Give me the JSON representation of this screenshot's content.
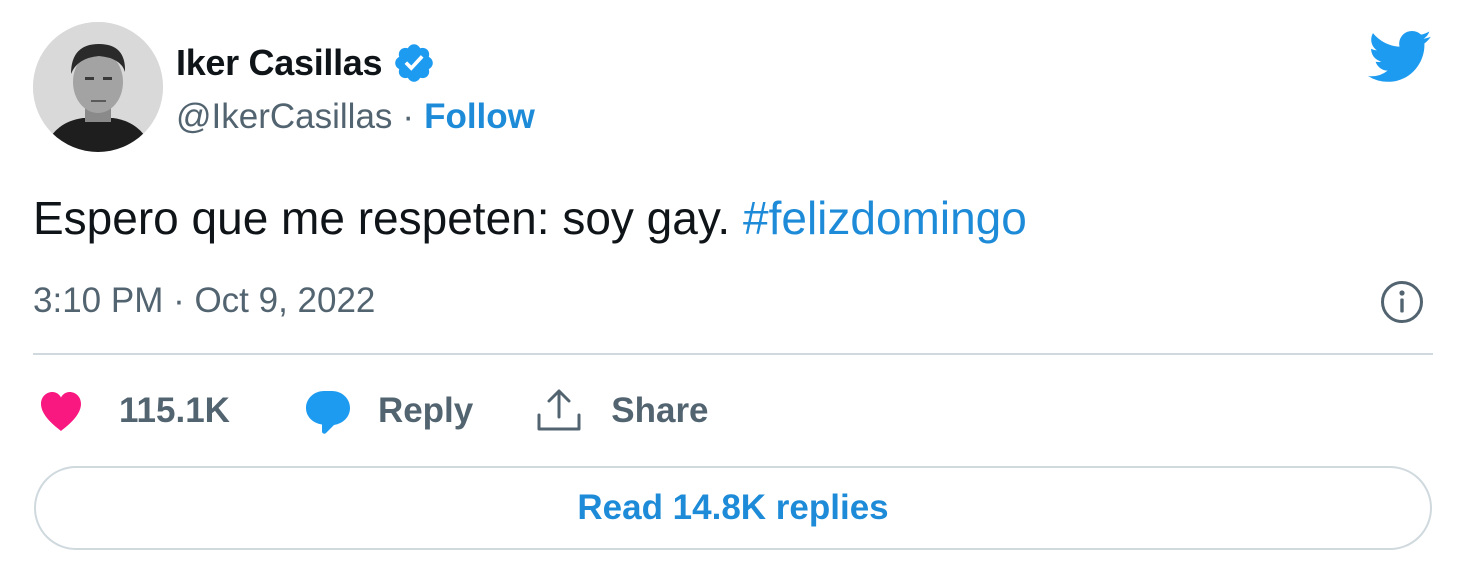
{
  "author": {
    "name": "Iker Casillas",
    "handle": "@IkerCasillas",
    "separator": "·",
    "follow_label": "Follow",
    "verified": true
  },
  "tweet": {
    "text": "Espero que me respeten: soy gay. ",
    "hashtag": "#felizdomingo",
    "timestamp": "3:10 PM · Oct 9, 2022"
  },
  "actions": {
    "like_count": "115.1K",
    "reply_label": "Reply",
    "share_label": "Share"
  },
  "read_replies_label": "Read 14.8K replies",
  "icons": {
    "logo": "twitter-bird-icon",
    "verified": "verified-badge-icon",
    "info": "info-icon",
    "like": "heart-icon",
    "reply": "speech-bubble-icon",
    "share": "share-upload-icon"
  },
  "colors": {
    "accent": "#1d8bd8",
    "like": "#f91880",
    "reply_icon": "#1d9bf0",
    "muted_text": "#536471",
    "divider": "#cfd9de",
    "text": "#0f1419"
  }
}
